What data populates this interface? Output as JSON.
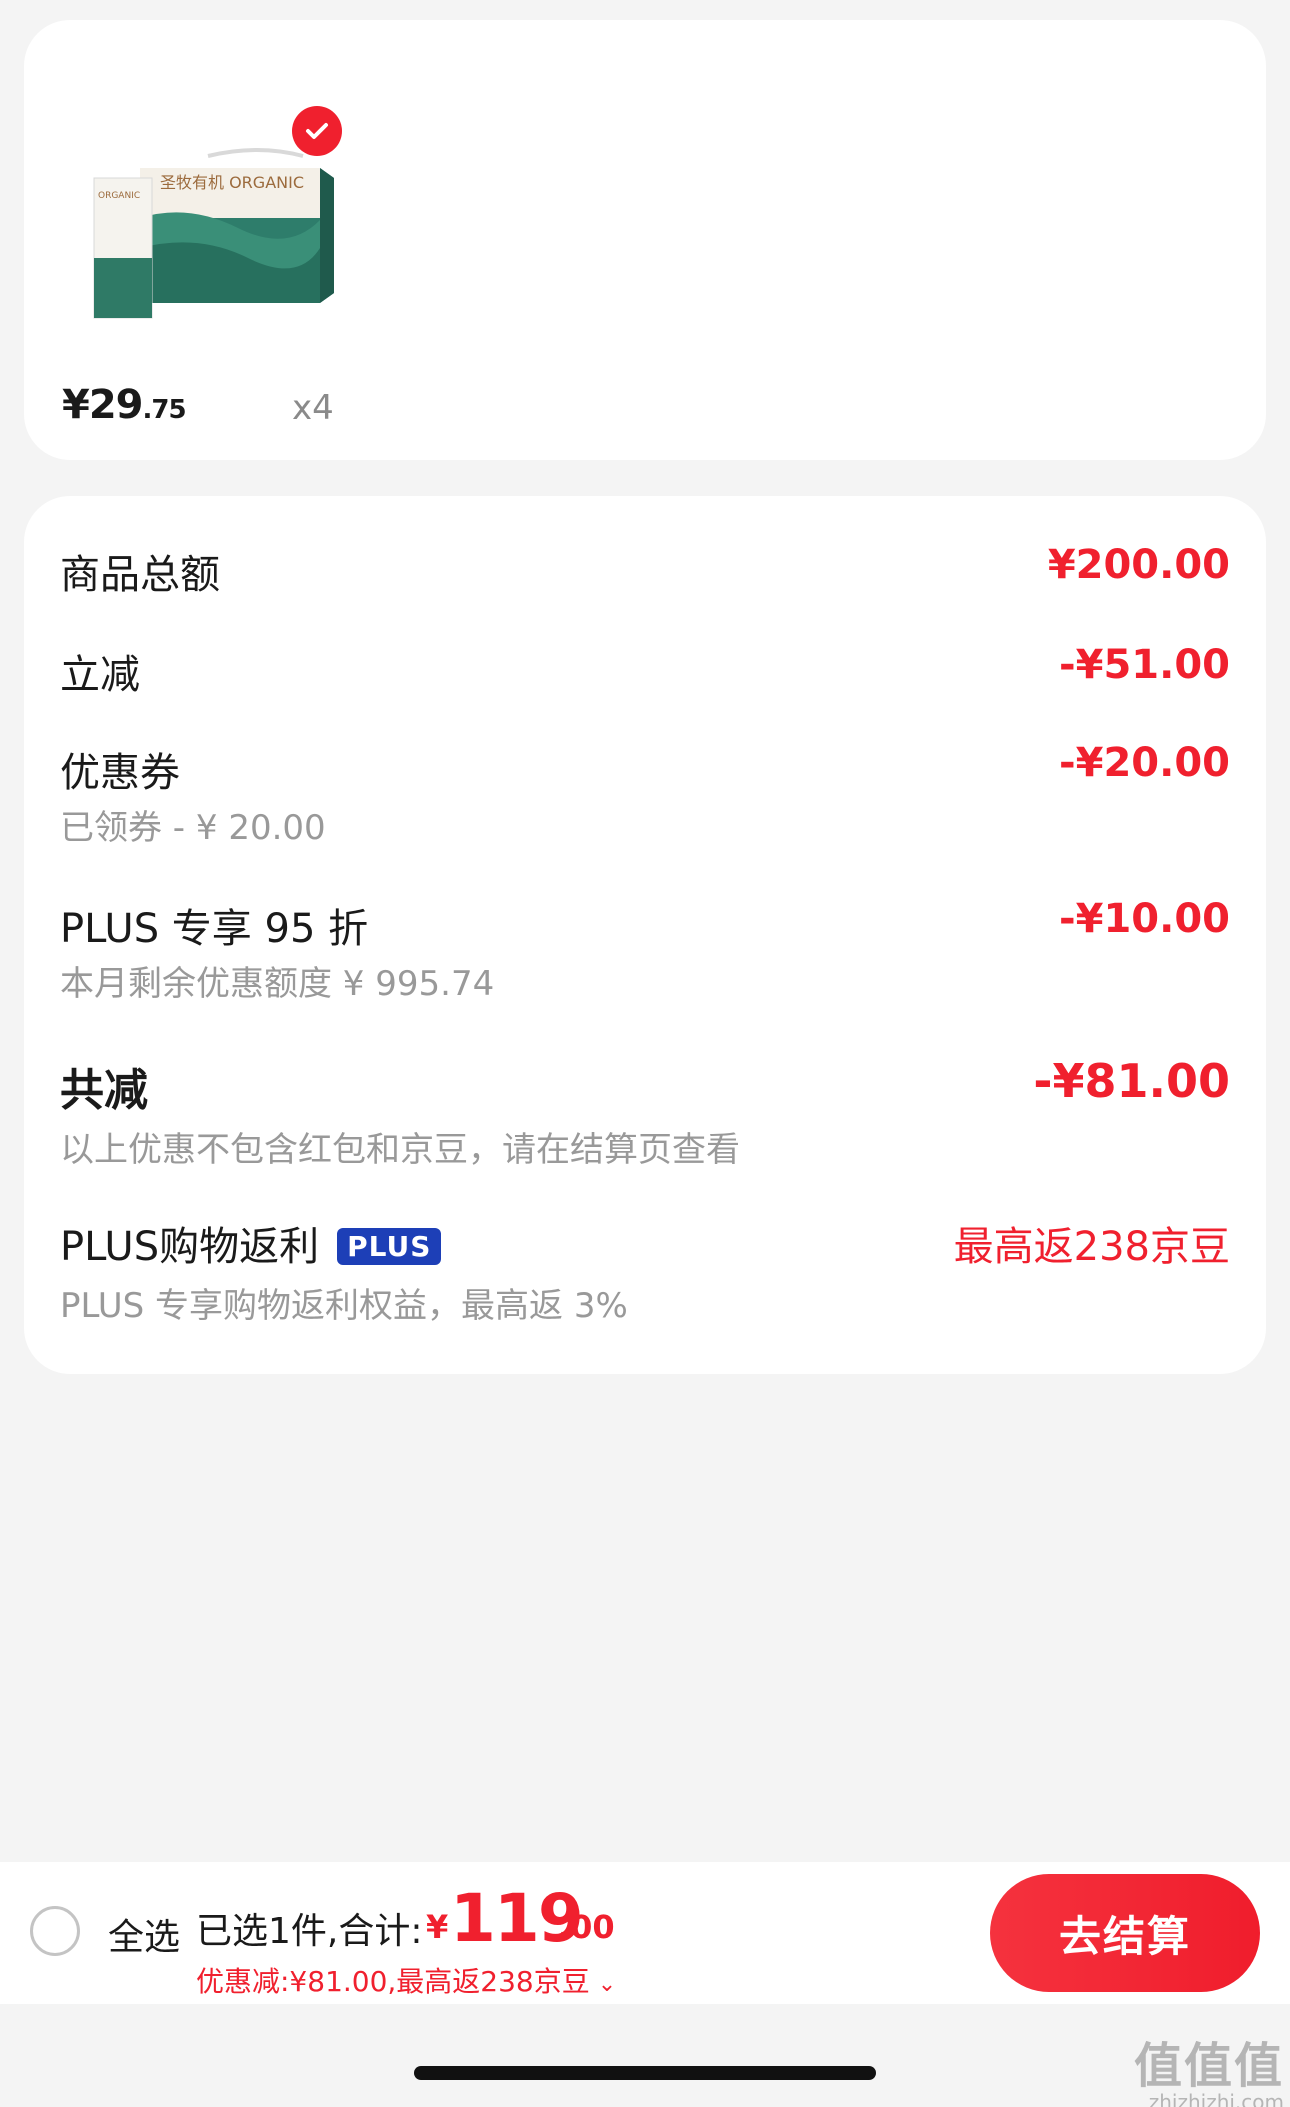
{
  "product": {
    "image_text": "圣牧有机 ORGANIC",
    "price_main": "¥29",
    "price_cents": ".75",
    "quantity": "x4",
    "checked": true
  },
  "summary": {
    "goods_total": {
      "label": "商品总额",
      "amount": "¥200.00"
    },
    "instant_reduction": {
      "label": "立减",
      "amount": "-¥51.00"
    },
    "coupon": {
      "label": "优惠券",
      "sub": "已领券 - ¥ 20.00",
      "amount": "-¥20.00"
    },
    "plus_discount": {
      "label": "PLUS 专享 95 折",
      "sub": "本月剩余优惠额度  ¥ 995.74",
      "amount": "-¥10.00"
    },
    "total_reduction": {
      "label": "共减",
      "sub": "以上优惠不包含红包和京豆，请在结算页查看",
      "amount": "-¥81.00"
    },
    "plus_rebate": {
      "label": "PLUS购物返利",
      "badge": "PLUS",
      "sub": "PLUS 专享购物返利权益，最高返 3%",
      "amount": "最高返238京豆"
    }
  },
  "bottom_bar": {
    "select_all": "全选",
    "selected_text": "已选1件,合计:",
    "total_yen": "¥",
    "total_int": "119",
    "total_dec": ".00",
    "discount_line": "优惠减:¥81.00,最高返238京豆",
    "checkout_label": "去结算"
  },
  "watermark": {
    "main": "值值值",
    "site": "zhizhizhi.com"
  },
  "colors": {
    "accent_red": "#f0202e",
    "plus_blue": "#1d3fb7",
    "background": "#f4f4f4"
  }
}
